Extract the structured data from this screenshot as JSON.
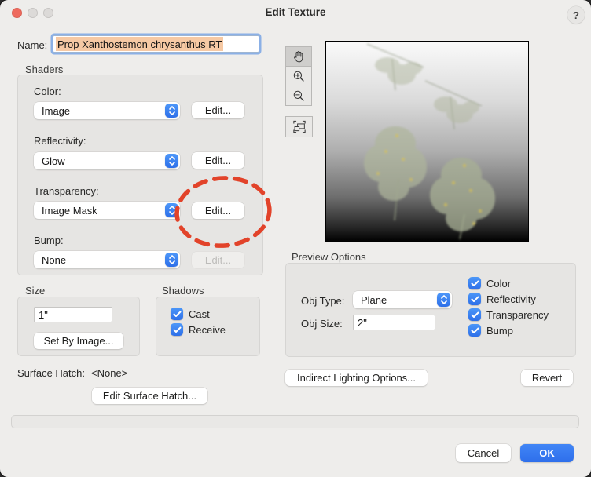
{
  "colors": {
    "accent_blue": "#3478f6",
    "annotation_red": "#e2432a",
    "selection_highlight": "#f6c9a4",
    "window_bg": "#eeedeb"
  },
  "titlebar": {
    "title": "Edit Texture",
    "help_label": "?"
  },
  "name_row": {
    "label": "Name:",
    "value": "Prop Xanthostemon chrysanthus RT"
  },
  "shaders": {
    "group_label": "Shaders",
    "rows": [
      {
        "label": "Color:",
        "value": "Image",
        "edit_label": "Edit..."
      },
      {
        "label": "Reflectivity:",
        "value": "Glow",
        "edit_label": "Edit..."
      },
      {
        "label": "Transparency:",
        "value": "Image Mask",
        "edit_label": "Edit..."
      },
      {
        "label": "Bump:",
        "value": "None",
        "edit_label": "Edit..."
      }
    ]
  },
  "size_group": {
    "group_label": "Size",
    "value": "1\"",
    "set_by_image_label": "Set By Image..."
  },
  "shadows_group": {
    "group_label": "Shadows",
    "cast_label": "Cast",
    "receive_label": "Receive"
  },
  "surface_hatch": {
    "label": "Surface Hatch:",
    "value": "<None>",
    "edit_label": "Edit Surface Hatch..."
  },
  "preview_options": {
    "group_label": "Preview Options",
    "obj_type_label": "Obj Type:",
    "obj_type_value": "Plane",
    "obj_size_label": "Obj Size:",
    "obj_size_value": "2\"",
    "checkboxes": [
      "Color",
      "Reflectivity",
      "Transparency",
      "Bump"
    ]
  },
  "footer": {
    "indirect_lighting_label": "Indirect Lighting Options...",
    "revert_label": "Revert",
    "cancel_label": "Cancel",
    "ok_label": "OK"
  }
}
